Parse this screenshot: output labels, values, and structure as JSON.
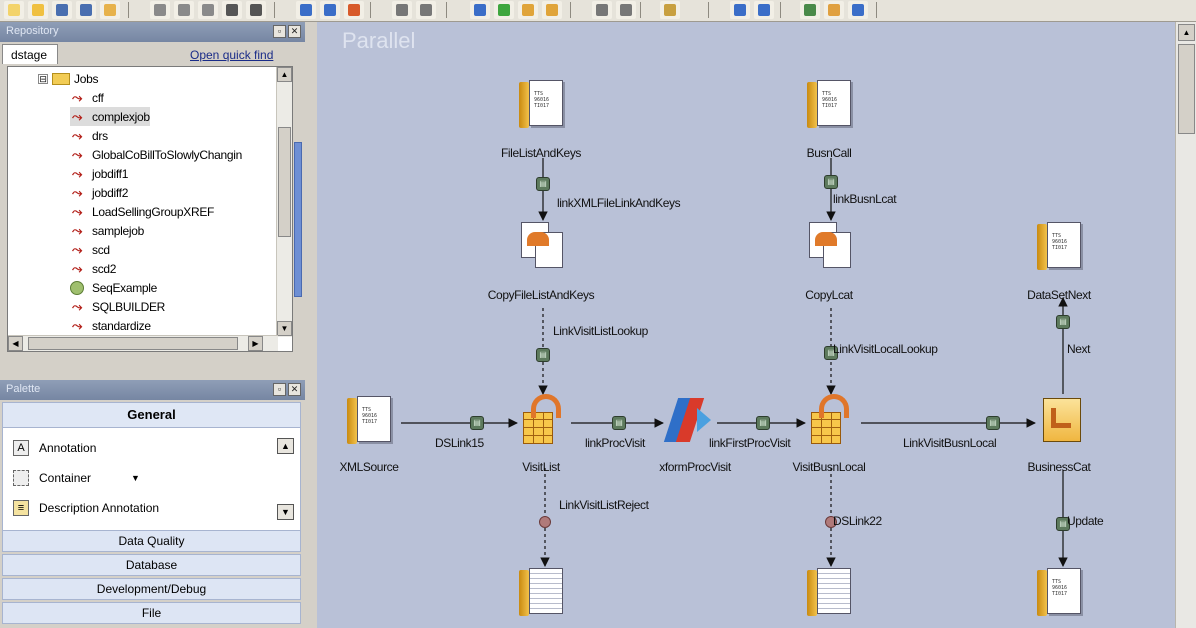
{
  "toolbar": {
    "buttons": [
      {
        "name": "new-job-icon",
        "color": "#f3d36a"
      },
      {
        "name": "open-icon",
        "color": "#f0c040"
      },
      {
        "name": "save-icon",
        "color": "#4a6fb0"
      },
      {
        "name": "save-all-icon",
        "color": "#4a6fb0"
      },
      {
        "name": "properties-icon",
        "color": "#e7b24b"
      },
      {
        "name": "cut-icon",
        "color": "#8a8a8a"
      },
      {
        "name": "copy-icon",
        "color": "#8a8a8a"
      },
      {
        "name": "paste-icon",
        "color": "#8a8a8a"
      },
      {
        "name": "undo-icon",
        "color": "#555555"
      },
      {
        "name": "redo-icon",
        "color": "#555555"
      },
      {
        "name": "find-icon",
        "color": "#3b6ec8"
      },
      {
        "name": "history-icon",
        "color": "#3b6ec8"
      },
      {
        "name": "link-icon",
        "color": "#d85a2a"
      },
      {
        "name": "grid-icon",
        "color": "#777777"
      },
      {
        "name": "snap-icon",
        "color": "#777777"
      },
      {
        "name": "compile-icon",
        "color": "#3b6ec8"
      },
      {
        "name": "run-icon",
        "color": "#3ea63e"
      },
      {
        "name": "job-properties-icon",
        "color": "#e0a43a"
      },
      {
        "name": "schedule-icon",
        "color": "#e0a43a"
      },
      {
        "name": "table-icon",
        "color": "#777777"
      },
      {
        "name": "print-icon",
        "color": "#777777"
      },
      {
        "name": "edit-icon",
        "color": "#c8a040"
      },
      {
        "name": "zoom-in-icon",
        "color": "#3b6ec8"
      },
      {
        "name": "zoom-out-icon",
        "color": "#3b6ec8"
      },
      {
        "name": "connect-icon",
        "color": "#4a8a4a"
      },
      {
        "name": "palette-icon",
        "color": "#e0a040"
      },
      {
        "name": "help-icon",
        "color": "#3b6ec8"
      }
    ]
  },
  "repository": {
    "title": "Repository",
    "tab_label": "dstage",
    "quick_find_label": "Open quick find",
    "folder": {
      "label": "Jobs",
      "expander": "⊟"
    },
    "items": [
      {
        "label": "cff",
        "type": "job",
        "highlighted": false
      },
      {
        "label": "complexjob",
        "type": "job",
        "highlighted": true
      },
      {
        "label": "drs",
        "type": "job",
        "highlighted": false
      },
      {
        "label": "GlobalCoBillToSlowlyChangin",
        "type": "job",
        "highlighted": false
      },
      {
        "label": "jobdiff1",
        "type": "job",
        "highlighted": false
      },
      {
        "label": "jobdiff2",
        "type": "job",
        "highlighted": false
      },
      {
        "label": "LoadSellingGroupXREF",
        "type": "job",
        "highlighted": false
      },
      {
        "label": "samplejob",
        "type": "job",
        "highlighted": false
      },
      {
        "label": "scd",
        "type": "job",
        "highlighted": false
      },
      {
        "label": "scd2",
        "type": "job",
        "highlighted": false
      },
      {
        "label": "SeqExample",
        "type": "sequence",
        "highlighted": false
      },
      {
        "label": "SQLBUILDER",
        "type": "job",
        "highlighted": false
      },
      {
        "label": "standardize",
        "type": "job",
        "highlighted": false
      }
    ]
  },
  "palette": {
    "title": "Palette",
    "general_label": "General",
    "items": [
      {
        "label": "Annotation",
        "icon": "annotation-icon"
      },
      {
        "label": "Container",
        "icon": "container-icon",
        "has_dropdown": true
      },
      {
        "label": "Description Annotation",
        "icon": "description-annotation-icon"
      }
    ],
    "categories": [
      "Data Quality",
      "Database",
      "Development/Debug",
      "File"
    ]
  },
  "canvas": {
    "title": "Parallel",
    "stages": [
      {
        "id": "filelist",
        "label": "FileListAndKeys",
        "kind": "file"
      },
      {
        "id": "copyfile",
        "label": "CopyFileListAndKeys",
        "kind": "copy"
      },
      {
        "id": "xmlsource",
        "label": "XMLSource",
        "kind": "file"
      },
      {
        "id": "visitlist",
        "label": "VisitList",
        "kind": "lookup"
      },
      {
        "id": "xform",
        "label": "xformProcVisit",
        "kind": "transformer"
      },
      {
        "id": "visitbusn",
        "label": "VisitBusnLocal",
        "kind": "lookup"
      },
      {
        "id": "busncall",
        "label": "BusnCall",
        "kind": "file"
      },
      {
        "id": "copylcat",
        "label": "CopyLcat",
        "kind": "copy"
      },
      {
        "id": "datasetnext",
        "label": "DataSetNext",
        "kind": "file"
      },
      {
        "id": "businesscat",
        "label": "BusinessCat",
        "kind": "cdc"
      },
      {
        "id": "reject1",
        "label": "",
        "kind": "seqfile"
      },
      {
        "id": "reject2",
        "label": "",
        "kind": "seqfile"
      },
      {
        "id": "update_out",
        "label": "",
        "kind": "file"
      }
    ],
    "links": [
      {
        "label": "linkXMLFileLinkAndKeys"
      },
      {
        "label": "LinkVisitListLookup"
      },
      {
        "label": "DSLink15"
      },
      {
        "label": "linkProcVisit"
      },
      {
        "label": "linkFirstProcVisit"
      },
      {
        "label": "LinkVisitListReject"
      },
      {
        "label": "linkBusnLcat"
      },
      {
        "label": "LinkVisitLocalLookup"
      },
      {
        "label": "DSLink22"
      },
      {
        "label": "LinkVisitBusnLocal"
      },
      {
        "label": "Next"
      },
      {
        "label": "Update"
      }
    ],
    "file_sheet_lines": [
      "TTS",
      "96016",
      "TI017"
    ]
  }
}
